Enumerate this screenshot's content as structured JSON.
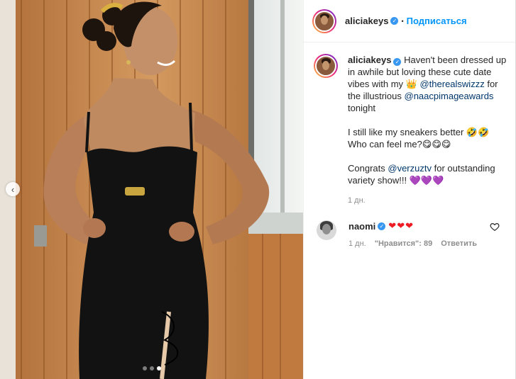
{
  "post": {
    "username": "aliciakeys",
    "follow_label": "Подписаться",
    "caption": {
      "intro": "Haven't been dressed up in awhile but loving these cute date vibes with my",
      "crown_emoji": "👑",
      "mention1": "@therealswizzz",
      "mid": "for the illustrious",
      "mention2": "@naacpimageawards",
      "end": "tonight",
      "p2": "I still like my sneakers better",
      "p2_emoji": "🤣🤣",
      "p2b": "Who can feel me?",
      "p2b_emoji": "😋😋😋",
      "p3_start": "Congrats",
      "mention3": "@verzuztv",
      "p3_end": "for outstanding variety show!!!",
      "p3_emoji": "💜💜💜"
    },
    "time": "1 дн."
  },
  "comment": {
    "username": "naomi",
    "text": "❤❤❤",
    "time": "1 дн.",
    "likes": "\"Нравится\": 89",
    "reply_label": "Ответить"
  },
  "carousel": {
    "prev_icon": "chevron-left-icon",
    "dots": 3,
    "active_dot": 3
  },
  "colors": {
    "accent": "#0095f6",
    "mention": "#00376b",
    "verified": "#3897f0",
    "heart": "#ed1c24"
  }
}
